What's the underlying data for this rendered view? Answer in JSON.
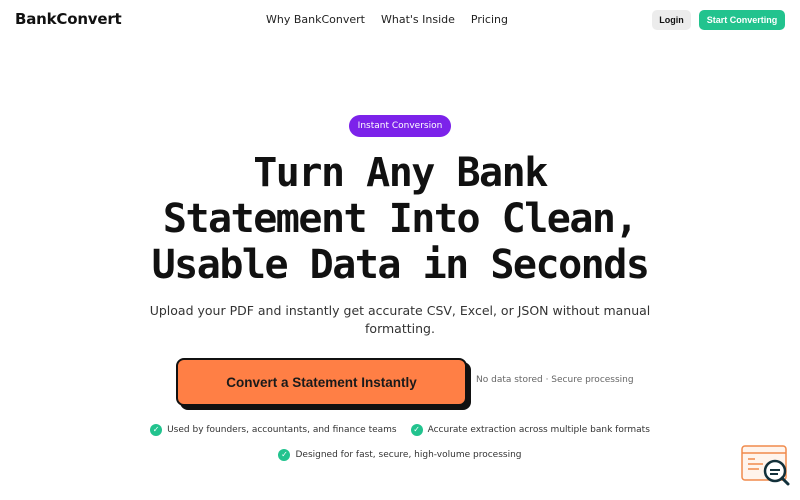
{
  "header": {
    "brand": "BankConvert",
    "nav": [
      "Why BankConvert",
      "What's Inside",
      "Pricing"
    ],
    "login_label": "Login",
    "start_label": "Start Converting"
  },
  "hero": {
    "badge": "Instant Conversion",
    "headline": [
      "Turn Any Bank",
      "Statement Into Clean,",
      "Usable Data in Seconds"
    ],
    "subtext": "Upload your PDF and instantly get accurate CSV, Excel, or JSON without manual formatting.",
    "cta_label": "Convert a Statement Instantly",
    "cta_note": "No data stored · Secure processing"
  },
  "features": [
    "Used by founders, accountants, and finance teams",
    "Accurate extraction across multiple bank formats",
    "Designed for fast, secure, high-volume processing"
  ],
  "colors": {
    "accent_green": "#22c38e",
    "accent_purple": "#7c22ea",
    "cta_orange": "#ff7f45"
  },
  "icons": {
    "check": "check-icon",
    "widget": "document-search-icon"
  }
}
